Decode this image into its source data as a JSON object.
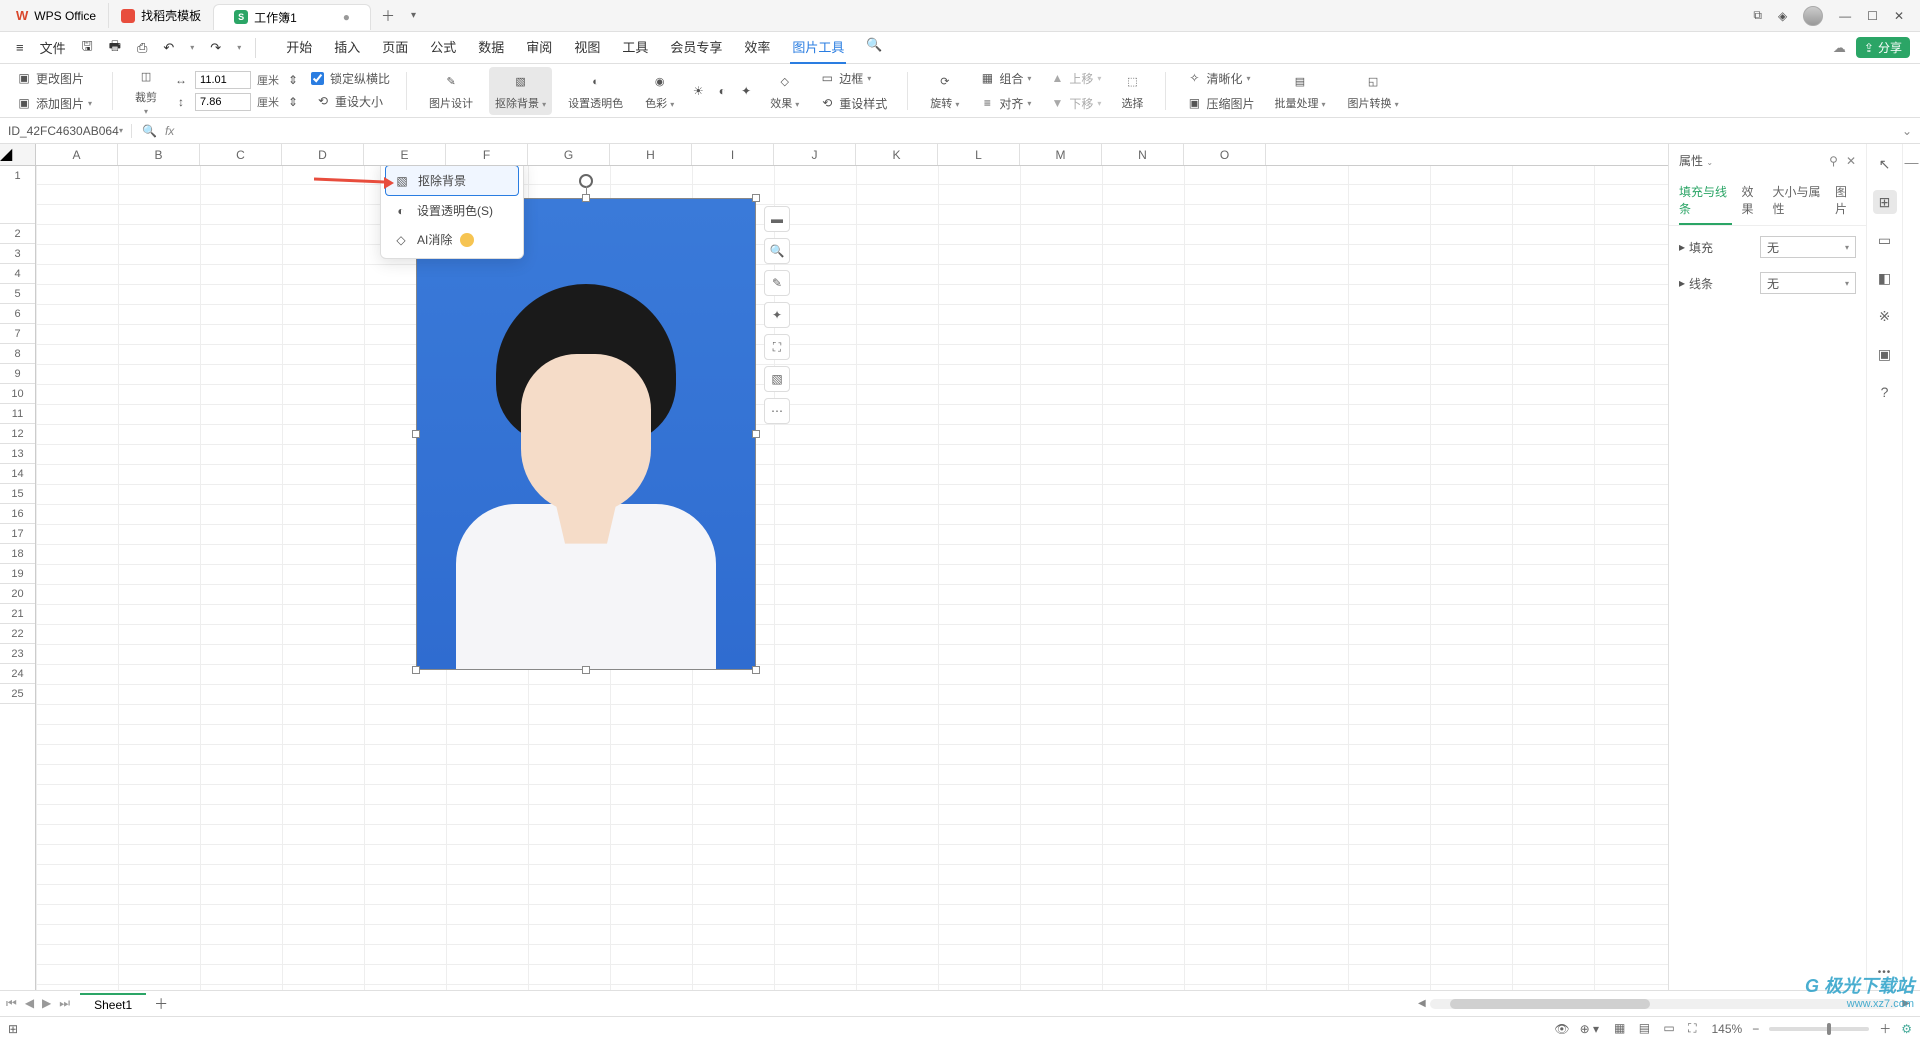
{
  "title": {
    "wps": "WPS Office",
    "templates": "找稻壳模板",
    "workbook": "工作簿1"
  },
  "menu": {
    "file": "文件",
    "tabs": {
      "start": "开始",
      "insert": "插入",
      "page": "页面",
      "formula": "公式",
      "data": "数据",
      "review": "审阅",
      "view": "视图",
      "tools": "工具",
      "member": "会员专享",
      "efficiency": "效率",
      "image_tools": "图片工具"
    },
    "share": "分享"
  },
  "ribbon": {
    "change_image": "更改图片",
    "add_image": "添加图片",
    "crop": "裁剪",
    "width_val": "11.01",
    "height_val": "7.86",
    "unit": "厘米",
    "lock_ratio": "锁定纵横比",
    "reset_size": "重设大小",
    "image_design": "图片设计",
    "remove_bg": "抠除背景",
    "set_transparent": "设置透明色",
    "color": "色彩",
    "effects": "效果",
    "reset_style": "重设样式",
    "border": "边框",
    "rotate": "旋转",
    "align": "对齐",
    "group": "组合",
    "move_up": "上移",
    "move_down": "下移",
    "select": "选择",
    "clear": "清晰化",
    "compress": "压缩图片",
    "batch": "批量处理",
    "convert": "图片转换"
  },
  "dropdown": {
    "remove_bg": "抠除背景",
    "set_transparent": "设置透明色(S)",
    "ai_remove": "AI消除"
  },
  "fbar": {
    "name": "ID_42FC4630AB064"
  },
  "columns": [
    "A",
    "B",
    "C",
    "D",
    "E",
    "F",
    "G",
    "H",
    "I",
    "J",
    "K",
    "L",
    "M",
    "N",
    "O"
  ],
  "rows": [
    "1",
    "2",
    "3",
    "4",
    "5",
    "6",
    "7",
    "8",
    "9",
    "10",
    "11",
    "12",
    "13",
    "14",
    "15",
    "16",
    "17",
    "18",
    "19",
    "20",
    "21",
    "22",
    "23",
    "24",
    "25"
  ],
  "float_tools": {
    "crop": "裁剪",
    "zoom": "缩放",
    "edit": "编辑",
    "magic": "魔法",
    "fit": "适应",
    "remove": "抠图",
    "more": "更多"
  },
  "props": {
    "title": "属性",
    "tabs": {
      "fill_line": "填充与线条",
      "effect": "效果",
      "size": "大小与属性",
      "picture": "图片"
    },
    "fill_label": "填充",
    "line_label": "线条",
    "none": "无"
  },
  "sheet": {
    "name": "Sheet1"
  },
  "status": {
    "zoom": "145%"
  },
  "watermark": {
    "name": "极光下载站",
    "url": "www.xz7.com"
  }
}
